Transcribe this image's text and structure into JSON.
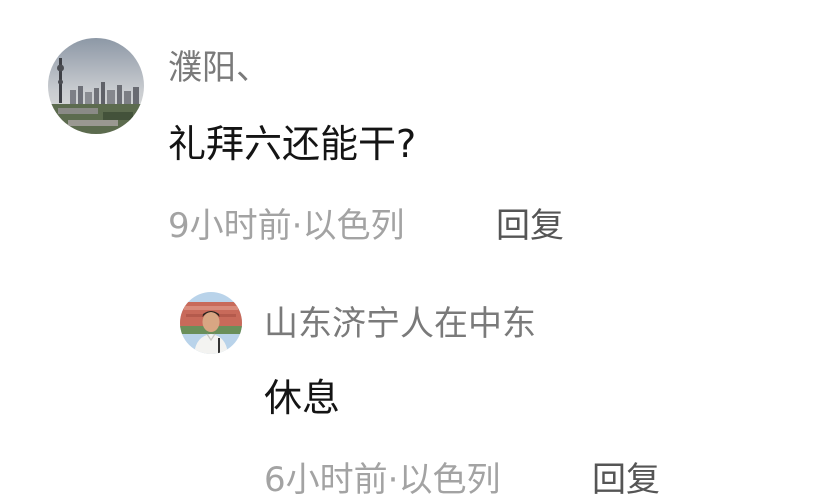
{
  "comments": [
    {
      "username": "濮阳、",
      "text": "礼拜六还能干?",
      "meta": "9小时前·以色列",
      "reply_label": "回复",
      "avatar": "city-skyline-avatar"
    },
    {
      "username": "山东济宁人在中东",
      "text": "休息",
      "meta": "6小时前·以色列",
      "reply_label": "回复",
      "avatar": "person-portrait-avatar"
    }
  ],
  "colors": {
    "username": "#7a7a7a",
    "content": "#141414",
    "meta": "#a3a3a3",
    "reply": "#555555",
    "background": "#ffffff"
  }
}
